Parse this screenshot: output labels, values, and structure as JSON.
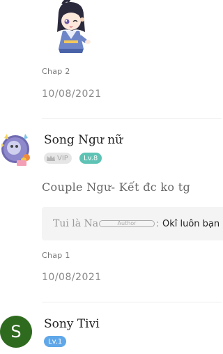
{
  "comments": [
    {
      "chap": "Chap 2",
      "date": "10/08/2021"
    },
    {
      "username": "Song Ngư nữ",
      "vip_label": "VIP",
      "level": "Lv.8",
      "text": "Couple Ngư- Kết đc ko tg",
      "reply": {
        "name": "Tui là Na",
        "author_label": "Author",
        "separator": ":",
        "text": "Okî luôn bạn"
      },
      "chap": "Chap 1",
      "date": "10/08/2021"
    },
    {
      "avatar_letter": "S",
      "username": "Sony Tivi",
      "level": "Lv.1"
    }
  ],
  "colors": {
    "level_teal": "#5ec3b5",
    "level_blue": "#5fa7e8",
    "avatar_green": "#2f6b1f"
  }
}
